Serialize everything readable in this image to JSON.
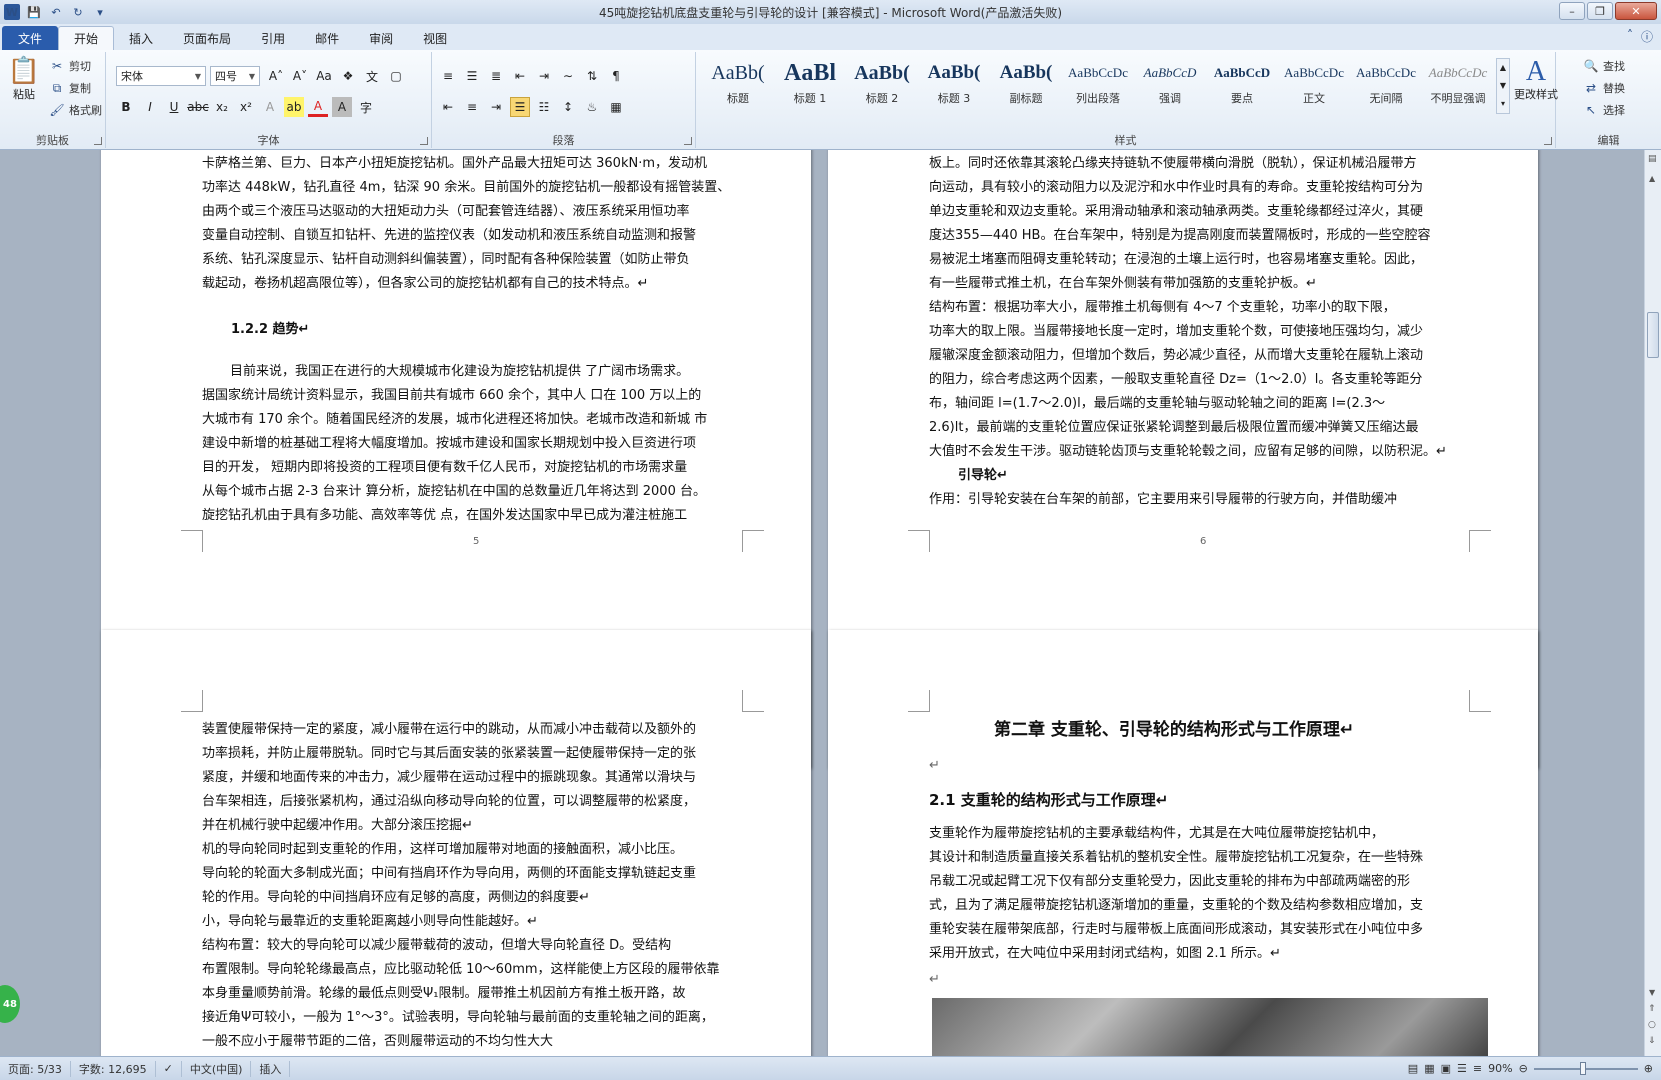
{
  "window": {
    "title": "45吨旋挖钻机底盘支重轮与引导轮的设计 [兼容模式] - Microsoft Word(产品激活失败)",
    "word_icon": "W"
  },
  "tabs": [
    "文件",
    "开始",
    "插入",
    "页面布局",
    "引用",
    "邮件",
    "审阅",
    "视图"
  ],
  "ribbon": {
    "clipboard": {
      "paste": "粘贴",
      "cut": "剪切",
      "copy": "复制",
      "format_painter": "格式刷",
      "label": "剪贴板"
    },
    "font": {
      "name": "宋体",
      "size": "四号",
      "label": "字体"
    },
    "paragraph": {
      "label": "段落"
    },
    "styles": {
      "label": "样式",
      "items": [
        {
          "sample": "AaBb(",
          "name": "标题"
        },
        {
          "sample": "AaBl",
          "name": "标题 1"
        },
        {
          "sample": "AaBb(",
          "name": "标题 2"
        },
        {
          "sample": "AaBb(",
          "name": "标题 3"
        },
        {
          "sample": "AaBb(",
          "name": "副标题"
        },
        {
          "sample": "AaBbCcDc",
          "name": "列出段落"
        },
        {
          "sample": "AaBbCcD",
          "name": "强调"
        },
        {
          "sample": "AaBbCcD",
          "name": "要点"
        },
        {
          "sample": "AaBbCcDc",
          "name": "正文"
        },
        {
          "sample": "AaBbCcDc",
          "name": "无间隔"
        },
        {
          "sample": "AaBbCcDc",
          "name": "不明显强调"
        }
      ],
      "change_styles": "更改样式"
    },
    "editing": {
      "find": "查找",
      "replace": "替换",
      "select": "选择",
      "label": "编辑"
    }
  },
  "pages": {
    "p5": {
      "lines": [
        "卡萨格兰第、巨力、日本产小扭矩旋挖钻机。国外产品最大扭矩可达 360kN·m，发动机",
        "功率达 448kW，钻孔直径 4m，钻深 90 余米。目前国外的旋挖钻机一般都设有摇管装置、",
        "由两个或三个液压马达驱动的大扭矩动力头（可配套管连结器）、液压系统采用恒功率",
        "变量自动控制、自锁互扣钻杆、先进的监控仪表（如发动机和液压系统自动监测和报警",
        "系统、钻孔深度显示、钻杆自动测斜纠偏装置），同时配有各种保险装置（如防止带负",
        "载起动，卷扬机超高限位等），但各家公司的旋挖钻机都有自己的技术特点。↵"
      ],
      "heading": "1.2.2 趋势↵",
      "lines2": [
        "目前来说，我国正在进行的大规模城市化建设为旋挖钻机提供  了广阔市场需求。",
        "据国家统计局统计资料显示，我国目前共有城市 660 余个，其中人  口在 100 万以上的",
        "大城市有 170 余个。随着国民经济的发展，城市化进程还将加快。老城市改造和新城  市",
        "建设中新增的桩基础工程将大幅度增加。按城市建设和国家长期规划中投入巨资进行项",
        "目的开发，  短期内即将投资的工程项目便有数千亿人民币，对旋挖钻机的市场需求量",
        "从每个城市占据 2-3 台来计  算分析，旋挖钻机在中国的总数量近几年将达到 2000 台。",
        "旋挖钻孔机由于具有多功能、高效率等优  点，在国外发达国家中早已成为灌注桩施工"
      ],
      "page_number": "5"
    },
    "p6": {
      "lines": [
        "板上。同时还依靠其滚轮凸缘夹持链轨不使履带横向滑脱（脱轨），保证机械沿履带方",
        "向运动，具有较小的滚动阻力以及泥泞和水中作业时具有的寿命。支重轮按结构可分为",
        "单边支重轮和双边支重轮。采用滑动轴承和滚动轴承两类。支重轮缘都经过淬火，其硬",
        "度达355—440 HB。在台车架中，特别是为提高刚度而装置隔板时，形成的一些空腔容",
        "易被泥土堵塞而阻碍支重轮转动；在浸泡的土壤上运行时，也容易堵塞支重轮。因此，",
        "有一些履带式推土机，在台车架外侧装有带加强筋的支重轮护板。↵",
        "    结构布置：根据功率大小，履带推土机每侧有 4～7 个支重轮，功率小的取下限，",
        "功率大的取上限。当履带接地长度一定时，增加支重轮个数，可使接地压强均匀，减少",
        "履辙深度金额滚动阻力，但增加个数后，势必减少直径，从而增大支重轮在履轨上滚动",
        "的阻力，综合考虑这两个因素，一般取支重轮直径 Dz=（1～2.0）l。各支重轮等距分",
        "布，轴间距 l=(1.7～2.0)l，最后端的支重轮轴与驱动轮轴之间的距离 l=(2.3～",
        "2.6)lt，最前端的支重轮位置应保证张紧轮调整到最后极限位置而缓冲弹簧又压缩达最",
        "大值时不会发生干涉。驱动链轮齿顶与支重轮轮毂之间，应留有足够的间隙，以防积泥。↵"
      ],
      "heading": "引导轮↵",
      "last_line": "    作用：引导轮安装在台车架的前部，它主要用来引导履带的行驶方向，并借助缓冲",
      "page_number": "6"
    },
    "p7": {
      "lines": [
        "装置使履带保持一定的紧度，减小履带在运行中的跳动，从而减小冲击载荷以及额外的",
        "功率损耗，并防止履带脱轨。同时它与其后面安装的张紧装置一起使履带保持一定的张",
        "紧度，并缓和地面传来的冲击力，减少履带在运动过程中的振跳现象。其通常以滑块与",
        "台车架相连，后接张紧机构，通过沿纵向移动导向轮的位置，可以调整履带的松紧度，",
        "并在机械行驶中起缓冲作用。大部分滚压挖掘↵",
        "  机的导向轮同时起到支重轮的作用，这样可增加履带对地面的接触面积，减小比压。",
        "导向轮的轮面大多制成光面；中间有挡肩环作为导向用，两侧的环面能支撑轨链起支重",
        "轮的作用。导向轮的中间挡肩环应有足够的高度，两侧边的斜度要↵",
        "  小，导向轮与最靠近的支重轮距离越小则导向性能越好。↵",
        "    结构布置：较大的导向轮可以减少履带载荷的波动，但增大导向轮直径 D。受结构",
        "布置限制。导向轮轮缘最高点，应比驱动轮低 10～60mm，这样能使上方区段的履带依靠",
        "本身重量顺势前滑。轮缘的最低点则受Ψ₁限制。履带推土机因前方有推土板开路，故",
        "接近角Ψ可较小，一般为 1°～3°。试验表明，导向轮轴与最前面的支重轮轴之间的距离，",
        "一般不应小于履带节距的二倍，否则履带运动的不均匀性大大"
      ]
    },
    "p8": {
      "chapter": "第二章   支重轮、引导轮的结构形式与工作原理↵",
      "section": "2.1 支重轮的结构形式与工作原理↵",
      "lines": [
        "    支重轮作为履带旋挖钻机的主要承载结构件，尤其是在大吨位履带旋挖钻机中，",
        "其设计和制造质量直接关系着钻机的整机安全性。履带旋挖钻机工况复杂，在一些特殊",
        "吊载工况或起臂工况下仅有部分支重轮受力，因此支重轮的排布为中部疏两端密的形",
        "式，且为了满足履带旋挖钻机逐渐增加的重量，支重轮的个数及结构参数相应增加，支",
        "重轮安装在履带架底部，行走时与履带板上底面间形成滚动，其安装形式在小吨位中多",
        "采用开放式，在大吨位中采用封闭式结构，如图 2.1  所示。↵"
      ]
    }
  },
  "badge": "48",
  "status": {
    "page": "页面: 5/33",
    "words": "字数: 12,695",
    "lang": "中文(中国)",
    "mode": "插入",
    "zoom": "90%"
  }
}
